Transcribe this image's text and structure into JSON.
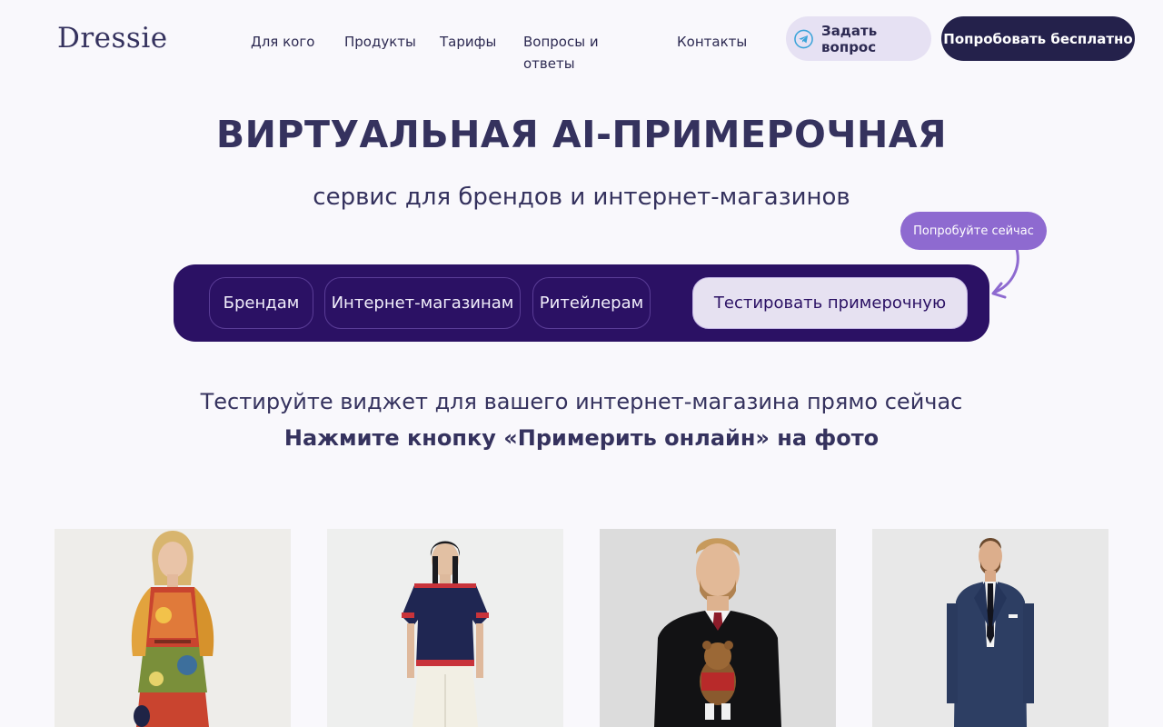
{
  "header": {
    "logo": "Dressie",
    "nav": [
      "Для кого",
      "Продукты",
      "Тарифы",
      "Вопросы и ответы",
      "Контакты"
    ],
    "ask_button": "Задать вопрос",
    "ask_icon": "telegram-icon",
    "try_button": "Попробовать бесплатно"
  },
  "hero": {
    "title": "ВИРТУАЛЬНАЯ AI-ПРИМЕРОЧНАЯ",
    "subtitle": "сервис для брендов и интернет-магазинов",
    "bubble": "Попробуйте сейчас"
  },
  "segments": {
    "items": [
      "Брендам",
      "Интернет-магазинам",
      "Ритейлерам"
    ],
    "test_button": "Тестировать примерочную"
  },
  "widget": {
    "line": "Тестируйте виджет для вашего интернет-магазина прямо сейчас",
    "bold": "Нажмите кнопку «Примерить онлайн» на фото"
  },
  "products": [
    {
      "image": "woman-floral-dress-photo"
    },
    {
      "image": "woman-navy-top-white-trousers-photo"
    },
    {
      "image": "man-bear-sweater-photo"
    },
    {
      "image": "man-navy-suit-photo"
    }
  ],
  "colors": {
    "brand_dark": "#24214b",
    "segment_bar": "#2b1164",
    "bubble": "#8e6ad0",
    "ask_bg": "#e6e1f3",
    "page_bg": "#f9f8fc"
  }
}
